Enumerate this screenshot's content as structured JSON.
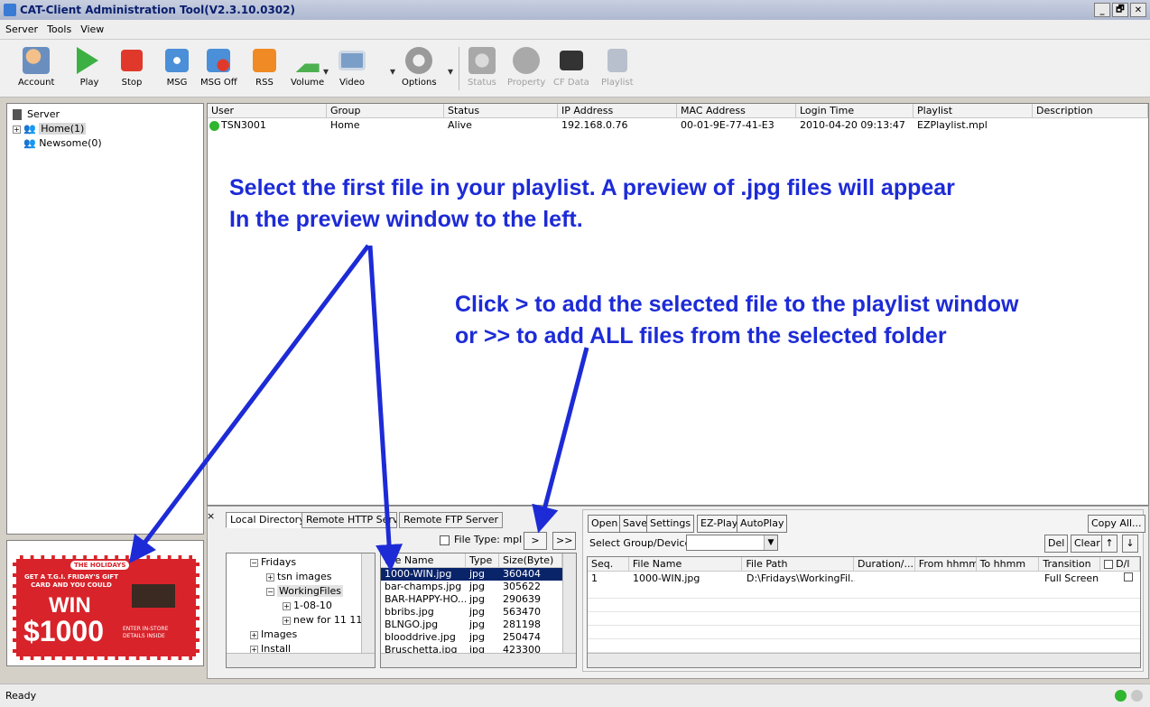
{
  "window": {
    "title": "CAT-Client Administration Tool(V2.3.10.0302)",
    "controls": [
      "_",
      "🗗",
      "✕"
    ]
  },
  "menu": [
    "Server",
    "Tools",
    "View"
  ],
  "toolbar": {
    "buttons": [
      {
        "label": "Account",
        "icon": "account-icon",
        "color": "#6a8fbf",
        "enabled": true
      },
      {
        "label": "Play",
        "icon": "play-icon",
        "color": "#3cb043",
        "enabled": true
      },
      {
        "label": "Stop",
        "icon": "stop-icon",
        "color": "#e0392b",
        "enabled": true
      },
      {
        "label": "MSG",
        "icon": "msg-icon",
        "color": "#4a8fd8",
        "enabled": true
      },
      {
        "label": "MSG Off",
        "icon": "msg-off-icon",
        "color": "#4a8fd8",
        "enabled": true
      },
      {
        "label": "RSS",
        "icon": "rss-icon",
        "color": "#f08a24",
        "enabled": true
      },
      {
        "label": "Volume",
        "icon": "volume-icon",
        "color": "#4caf50",
        "enabled": true
      },
      {
        "label": "Video",
        "icon": "video-icon",
        "color": "#7a9ec8",
        "enabled": true
      },
      {
        "label": "Options",
        "icon": "options-icon",
        "color": "#9a9a9a",
        "enabled": true
      },
      {
        "label": "Status",
        "icon": "status-icon",
        "color": "#8a8a8a",
        "enabled": false
      },
      {
        "label": "Property",
        "icon": "property-icon",
        "color": "#8a8a8a",
        "enabled": false
      },
      {
        "label": "CF Data",
        "icon": "cf-data-icon",
        "color": "#333333",
        "enabled": false
      },
      {
        "label": "Playlist",
        "icon": "playlist-icon",
        "color": "#aab4c4",
        "enabled": false
      }
    ]
  },
  "tree": {
    "root": "Server",
    "nodes": [
      {
        "label": "Home(1)",
        "selected": true
      },
      {
        "label": "Newsome(0)",
        "selected": false
      }
    ]
  },
  "clients": {
    "columns": [
      "User",
      "Group",
      "Status",
      "IP Address",
      "MAC Address",
      "Login Time",
      "Playlist",
      "Description"
    ],
    "rows": [
      [
        "TSN3001",
        "Home",
        "Alive",
        "192.168.0.76",
        "00-01-9E-77-41-E3",
        "2010-04-20 09:13:47",
        "EZPlaylist.mpl",
        ""
      ]
    ]
  },
  "annotations": {
    "a1_line1": "Select the first file in your playlist.  A preview of .jpg files will appear",
    "a1_line2": "In the preview window to the left.",
    "a2_line1": "Click > to add the selected file to the playlist window",
    "a2_line2": "or >> to add ALL files from the selected folder",
    "color": "#1d2bd6"
  },
  "preview": {
    "header_text": "GET A T.G.I. FRIDAY'S GIFT CARD AND YOU COULD",
    "win_text": "WIN",
    "amount": "$1000",
    "small_text": "ENTER IN-STORE DETAILS INSIDE",
    "banner": "THE HOLIDAYS",
    "color": "#d8232a"
  },
  "tabs": [
    "Local Directory",
    "Remote HTTP Serve",
    "Remote FTP Server"
  ],
  "local": {
    "filetype_label": "File Type: mpl",
    "add_one": ">",
    "add_all": ">>",
    "folder_tree": [
      {
        "label": "Fridays",
        "indent": 0,
        "sign": "−"
      },
      {
        "label": "tsn images",
        "indent": 1,
        "sign": "+"
      },
      {
        "label": "WorkingFiles",
        "indent": 1,
        "sign": "−"
      },
      {
        "label": "1-08-10",
        "indent": 2,
        "sign": "+"
      },
      {
        "label": "new for 11 11",
        "indent": 2,
        "sign": "+"
      },
      {
        "label": "Images",
        "indent": 0,
        "sign": "+"
      },
      {
        "label": "Install",
        "indent": 0,
        "sign": "+"
      }
    ],
    "file_columns": [
      "File Name",
      "Type",
      "Size(Byte)"
    ],
    "files": [
      [
        "1000-WIN.jpg",
        "jpg",
        "360404"
      ],
      [
        "bar-champs.jpg",
        "jpg",
        "305622"
      ],
      [
        "BAR-HAPPY-HO...",
        "jpg",
        "290639"
      ],
      [
        "bbribs.jpg",
        "jpg",
        "563470"
      ],
      [
        "BLNGO.jpg",
        "jpg",
        "281198"
      ],
      [
        "blooddrive.jpg",
        "jpg",
        "250474"
      ],
      [
        "Bruschetta.jpg",
        "jpg",
        "423300"
      ]
    ]
  },
  "playlist": {
    "buttons": [
      "Open",
      "Save",
      "Settings",
      "EZ-Play",
      "AutoPlay",
      "Copy All...",
      "Del",
      "Clear",
      "↑",
      "↓"
    ],
    "group_label": "Select Group/Device",
    "columns": [
      "Seq.",
      "File Name",
      "File Path",
      "Duration/...",
      "From hhmm",
      "To hhmm",
      "Transition",
      "D/l"
    ],
    "rows": [
      [
        "1",
        "1000-WIN.jpg",
        "D:\\Fridays\\WorkingFil...",
        "",
        "",
        "",
        "Full Screen",
        ""
      ]
    ]
  },
  "status": {
    "text": "Ready"
  }
}
